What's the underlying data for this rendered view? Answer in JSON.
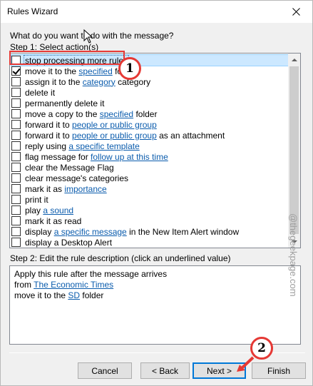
{
  "window": {
    "title": "Rules Wizard"
  },
  "question": "What do you want to do with the message?",
  "step1_label": "Step 1: Select action(s)",
  "actions": [
    {
      "parts": [
        {
          "t": "stop processing more rules"
        }
      ],
      "checked": false,
      "selected": true
    },
    {
      "parts": [
        {
          "t": "move it to the "
        },
        {
          "t": "specified",
          "link": true
        },
        {
          "t": " folder"
        }
      ],
      "checked": true
    },
    {
      "parts": [
        {
          "t": "assign it to the "
        },
        {
          "t": "category",
          "link": true
        },
        {
          "t": " category"
        }
      ],
      "checked": false
    },
    {
      "parts": [
        {
          "t": "delete it"
        }
      ],
      "checked": false
    },
    {
      "parts": [
        {
          "t": "permanently delete it"
        }
      ],
      "checked": false
    },
    {
      "parts": [
        {
          "t": "move a copy to the "
        },
        {
          "t": "specified",
          "link": true
        },
        {
          "t": " folder"
        }
      ],
      "checked": false
    },
    {
      "parts": [
        {
          "t": "forward it to "
        },
        {
          "t": "people or public group",
          "link": true
        }
      ],
      "checked": false
    },
    {
      "parts": [
        {
          "t": "forward it to "
        },
        {
          "t": "people or public group",
          "link": true
        },
        {
          "t": " as an attachment"
        }
      ],
      "checked": false
    },
    {
      "parts": [
        {
          "t": "reply using "
        },
        {
          "t": "a specific template",
          "link": true
        }
      ],
      "checked": false
    },
    {
      "parts": [
        {
          "t": "flag message for "
        },
        {
          "t": "follow up at this time",
          "link": true
        }
      ],
      "checked": false
    },
    {
      "parts": [
        {
          "t": "clear the Message Flag"
        }
      ],
      "checked": false
    },
    {
      "parts": [
        {
          "t": "clear message's categories"
        }
      ],
      "checked": false
    },
    {
      "parts": [
        {
          "t": "mark it as "
        },
        {
          "t": "importance",
          "link": true
        }
      ],
      "checked": false
    },
    {
      "parts": [
        {
          "t": "print it"
        }
      ],
      "checked": false
    },
    {
      "parts": [
        {
          "t": "play "
        },
        {
          "t": "a sound",
          "link": true
        }
      ],
      "checked": false
    },
    {
      "parts": [
        {
          "t": "mark it as read"
        }
      ],
      "checked": false
    },
    {
      "parts": [
        {
          "t": "display "
        },
        {
          "t": "a specific message",
          "link": true
        },
        {
          "t": " in the New Item Alert window"
        }
      ],
      "checked": false
    },
    {
      "parts": [
        {
          "t": "display a Desktop Alert"
        }
      ],
      "checked": false
    }
  ],
  "step2_label": "Step 2: Edit the rule description (click an underlined value)",
  "description": [
    [
      {
        "t": "Apply this rule after the message arrives"
      }
    ],
    [
      {
        "t": "from "
      },
      {
        "t": "The Economic Times",
        "link": true
      }
    ],
    [
      {
        "t": "move it to the "
      },
      {
        "t": "SD",
        "link": true
      },
      {
        "t": " folder"
      }
    ]
  ],
  "buttons": {
    "cancel": "Cancel",
    "back": "< Back",
    "next": "Next >",
    "finish": "Finish"
  },
  "annotations": {
    "badge1": "1",
    "badge2": "2",
    "highlight_color": "#e53935"
  },
  "watermark": "@thegeekpage.com",
  "colors": {
    "link": "#0b5cad",
    "selection": "#cce8ff",
    "default_button_border": "#0078d7"
  }
}
